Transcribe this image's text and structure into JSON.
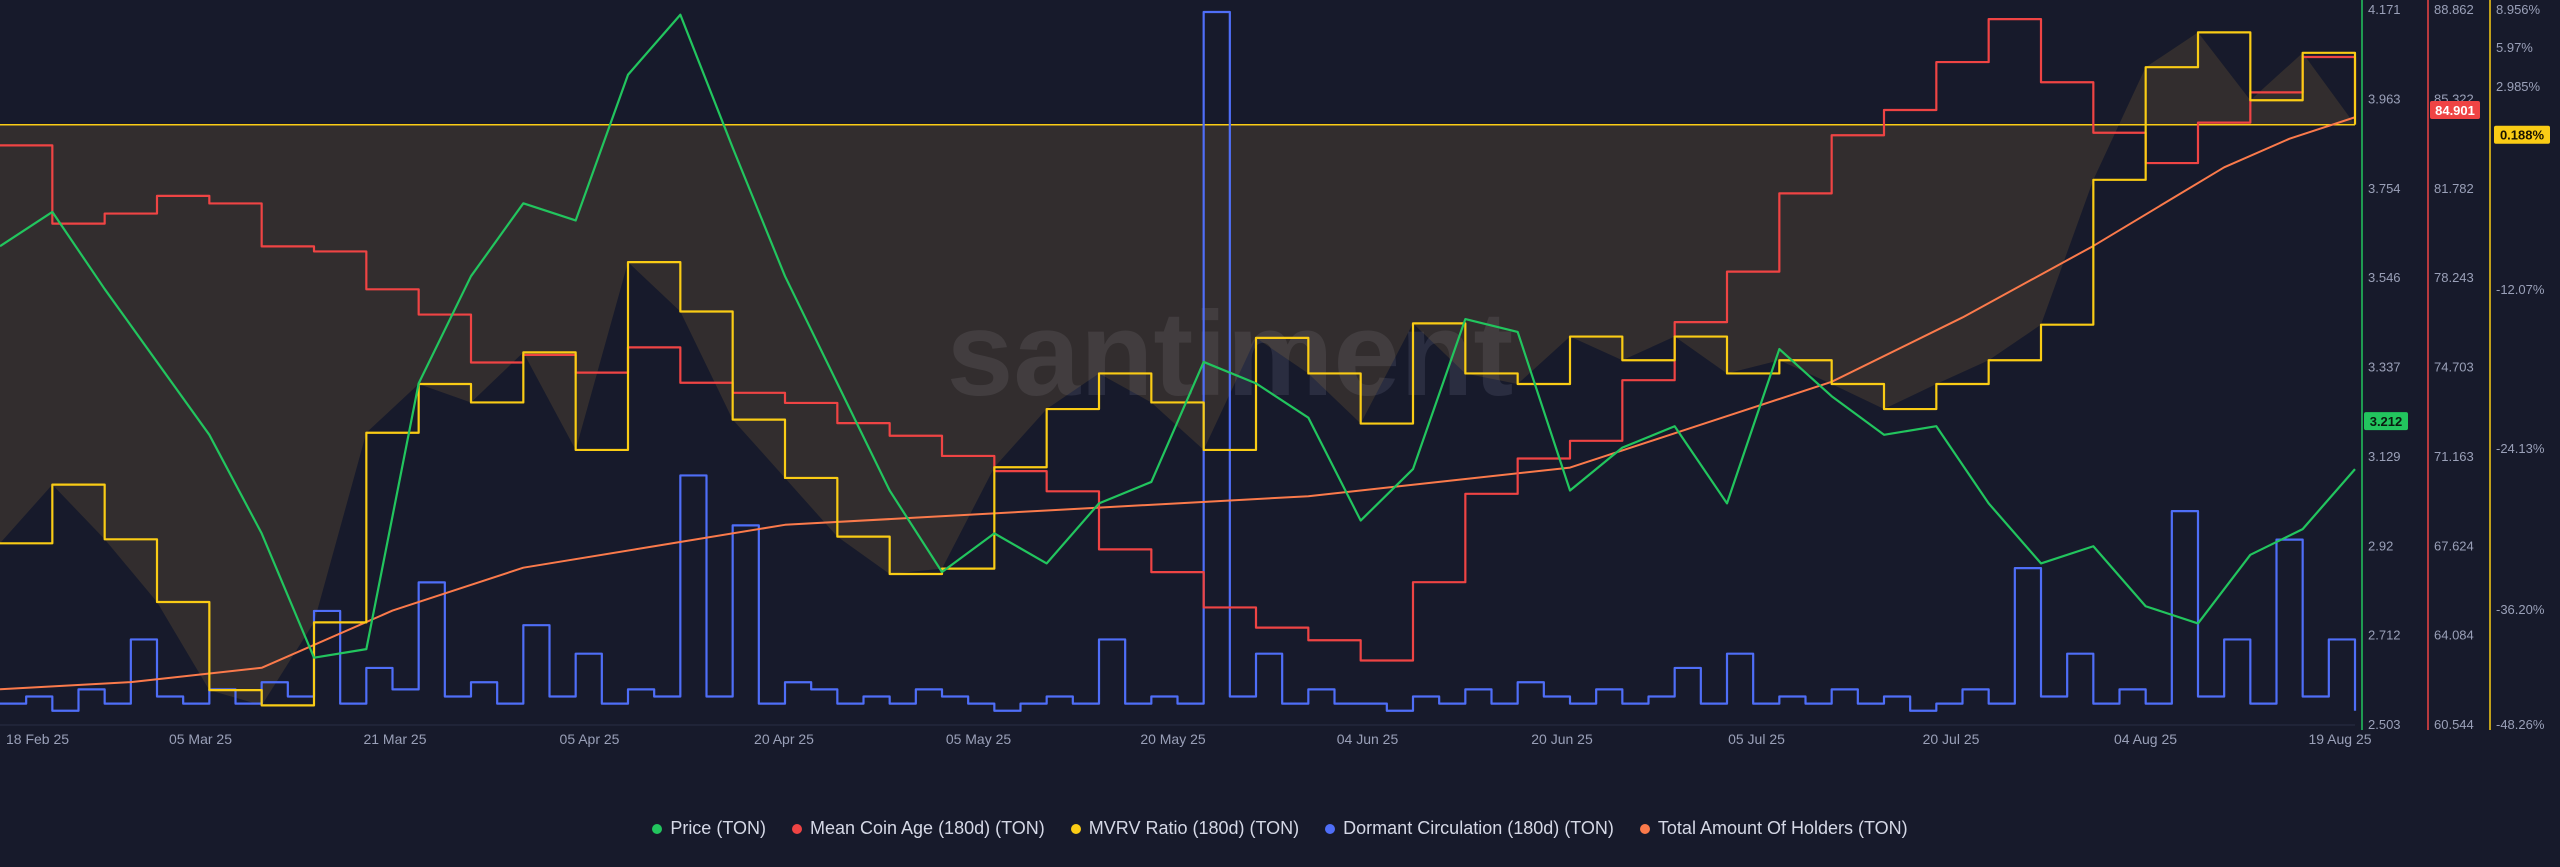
{
  "chart_data": {
    "type": "line",
    "watermark": "santiment",
    "x": {
      "ticks": [
        "18 Feb 25",
        "05 Mar 25",
        "21 Mar 25",
        "05 Apr 25",
        "20 Apr 25",
        "05 May 25",
        "20 May 25",
        "04 Jun 25",
        "20 Jun 25",
        "05 Jul 25",
        "20 Jul 25",
        "04 Aug 25",
        "19 Aug 25"
      ]
    },
    "axes": {
      "price": {
        "ticks": [
          "4.171",
          "3.963",
          "3.754",
          "3.546",
          "3.337",
          "3.129",
          "2.92",
          "2.712",
          "2.503"
        ],
        "min": 2.503,
        "max": 4.171,
        "color": "#22c55e",
        "current": "3.212"
      },
      "coin_age": {
        "ticks": [
          "88.862",
          "85.322",
          "81.782",
          "78.243",
          "74.703",
          "71.163",
          "67.624",
          "64.084",
          "60.544"
        ],
        "min": 60.544,
        "max": 88.862,
        "color": "#ef4444",
        "current": "84.901"
      },
      "mvrv": {
        "ticks": [
          "8.956%",
          "5.97%",
          "2.985%",
          "-12.07%",
          "-24.13%",
          "-36.20%",
          "-48.26%"
        ],
        "tick_values": [
          8.956,
          5.97,
          2.985,
          -12.07,
          -24.13,
          -36.2,
          -48.26
        ],
        "current": "0.188%",
        "current_value": 0.188,
        "color": "#facc15"
      }
    },
    "series": [
      {
        "name": "Price (TON)",
        "color": "#22c55e",
        "axis": "price",
        "x": [
          0,
          4,
          8,
          12,
          16,
          20,
          24,
          28,
          32,
          36,
          40,
          44,
          48,
          52,
          56,
          60,
          64,
          68,
          72,
          76,
          80,
          84,
          88,
          92,
          96,
          100,
          104,
          108,
          112,
          116,
          120,
          124,
          128,
          132,
          136,
          140,
          144,
          148,
          152,
          156,
          160,
          164,
          168,
          172,
          176,
          180
        ],
        "y": [
          3.62,
          3.7,
          3.52,
          3.35,
          3.18,
          2.95,
          2.66,
          2.68,
          3.3,
          3.55,
          3.72,
          3.68,
          4.02,
          4.16,
          3.85,
          3.55,
          3.3,
          3.05,
          2.86,
          2.95,
          2.88,
          3.02,
          3.07,
          3.35,
          3.3,
          3.22,
          2.98,
          3.1,
          3.45,
          3.42,
          3.05,
          3.15,
          3.2,
          3.02,
          3.38,
          3.27,
          3.18,
          3.2,
          3.02,
          2.88,
          2.92,
          2.78,
          2.74,
          2.9,
          2.96,
          3.1
        ]
      },
      {
        "name": "Mean Coin Age (180d) (TON)",
        "color": "#ef4444",
        "axis": "coin_age",
        "x": [
          0,
          4,
          8,
          12,
          16,
          20,
          24,
          28,
          32,
          36,
          40,
          44,
          48,
          52,
          56,
          60,
          64,
          68,
          72,
          76,
          80,
          84,
          88,
          92,
          96,
          100,
          104,
          108,
          112,
          116,
          120,
          124,
          128,
          132,
          136,
          140,
          144,
          148,
          152,
          156,
          160,
          164,
          168,
          172,
          176,
          180
        ],
        "y": [
          83.5,
          80.4,
          80.8,
          81.5,
          81.2,
          79.5,
          79.3,
          77.8,
          76.8,
          74.9,
          75.2,
          74.5,
          75.5,
          74.1,
          73.7,
          73.3,
          72.5,
          72.0,
          71.2,
          70.6,
          69.8,
          67.5,
          66.6,
          65.2,
          64.4,
          63.9,
          63.1,
          66.2,
          69.7,
          71.1,
          71.8,
          74.2,
          76.5,
          78.5,
          81.6,
          83.9,
          84.9,
          86.8,
          88.5,
          86.0,
          84.0,
          82.8,
          84.4,
          85.6,
          87.0,
          84.9
        ]
      },
      {
        "name": "MVRV Ratio (180d) (TON)",
        "color": "#facc15",
        "axis": "mvrv",
        "x": [
          0,
          4,
          8,
          12,
          16,
          20,
          24,
          28,
          32,
          36,
          40,
          44,
          48,
          52,
          56,
          60,
          64,
          68,
          72,
          76,
          80,
          84,
          88,
          92,
          96,
          100,
          104,
          108,
          112,
          116,
          120,
          124,
          128,
          132,
          136,
          140,
          144,
          148,
          152,
          156,
          160,
          164,
          168,
          172,
          176,
          180
        ],
        "y": [
          -31.2,
          -26.8,
          -30.9,
          -35.6,
          -44.6,
          -46.2,
          -37.5,
          -22.9,
          -19.2,
          -20.6,
          -16.8,
          -24.2,
          -10.0,
          -13.7,
          -21.9,
          -26.3,
          -30.7,
          -33.5,
          -33.1,
          -25.5,
          -21.1,
          -18.4,
          -20.6,
          -24.2,
          -15.7,
          -18.4,
          -22.2,
          -14.6,
          -18.4,
          -19.2,
          -15.6,
          -17.4,
          -15.6,
          -18.4,
          -17.4,
          -19.2,
          -21.1,
          -19.2,
          -17.4,
          -14.7,
          -3.9,
          4.5,
          7.2,
          2.0,
          5.6,
          0.19
        ]
      },
      {
        "name": "Dormant Circulation (180d) (TON)",
        "color": "#4f6ef7",
        "axis": "dormant",
        "x": [
          0,
          2,
          4,
          6,
          8,
          10,
          12,
          14,
          16,
          18,
          20,
          22,
          24,
          26,
          28,
          30,
          32,
          34,
          36,
          38,
          40,
          42,
          44,
          46,
          48,
          50,
          52,
          54,
          56,
          58,
          60,
          62,
          64,
          66,
          68,
          70,
          72,
          74,
          76,
          78,
          80,
          82,
          84,
          86,
          88,
          90,
          92,
          94,
          96,
          98,
          100,
          102,
          104,
          106,
          108,
          110,
          112,
          114,
          116,
          118,
          120,
          122,
          124,
          126,
          128,
          130,
          132,
          134,
          136,
          138,
          140,
          142,
          144,
          146,
          148,
          150,
          152,
          154,
          156,
          158,
          160,
          162,
          164,
          166,
          168,
          170,
          172,
          174,
          176,
          178,
          180
        ],
        "y": [
          0.03,
          0.04,
          0.02,
          0.05,
          0.03,
          0.12,
          0.04,
          0.03,
          0.05,
          0.03,
          0.06,
          0.04,
          0.16,
          0.03,
          0.08,
          0.05,
          0.2,
          0.04,
          0.06,
          0.03,
          0.14,
          0.04,
          0.1,
          0.03,
          0.05,
          0.04,
          0.35,
          0.04,
          0.28,
          0.03,
          0.06,
          0.05,
          0.03,
          0.04,
          0.03,
          0.05,
          0.04,
          0.03,
          0.02,
          0.03,
          0.04,
          0.03,
          0.12,
          0.03,
          0.04,
          0.03,
          1.0,
          0.04,
          0.1,
          0.03,
          0.05,
          0.03,
          0.03,
          0.02,
          0.04,
          0.03,
          0.05,
          0.03,
          0.06,
          0.04,
          0.03,
          0.05,
          0.03,
          0.04,
          0.08,
          0.03,
          0.1,
          0.03,
          0.04,
          0.03,
          0.05,
          0.03,
          0.04,
          0.02,
          0.03,
          0.05,
          0.03,
          0.22,
          0.04,
          0.1,
          0.03,
          0.05,
          0.03,
          0.3,
          0.04,
          0.12,
          0.03,
          0.26,
          0.04,
          0.12,
          0.02
        ]
      },
      {
        "name": "Total Amount Of Holders (TON)",
        "color": "#fb7a4b",
        "axis": "holders",
        "x": [
          0,
          10,
          20,
          30,
          40,
          50,
          60,
          70,
          80,
          90,
          100,
          110,
          120,
          130,
          140,
          150,
          160,
          170,
          175,
          180
        ],
        "y": [
          0.05,
          0.06,
          0.08,
          0.16,
          0.22,
          0.25,
          0.28,
          0.29,
          0.3,
          0.31,
          0.32,
          0.34,
          0.36,
          0.42,
          0.48,
          0.57,
          0.67,
          0.78,
          0.82,
          0.85
        ]
      }
    ],
    "legend_position": "bottom"
  }
}
